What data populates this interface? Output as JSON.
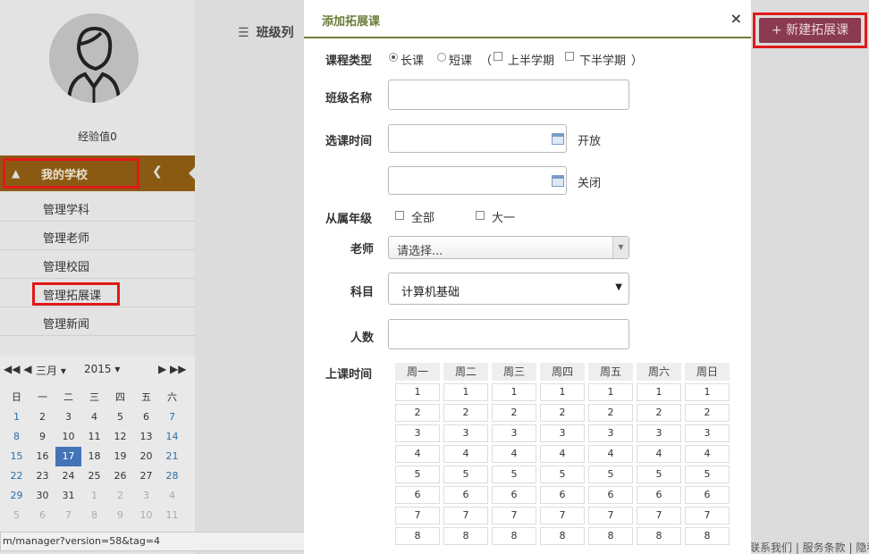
{
  "sidebar": {
    "exp_label": "经验值0",
    "school": {
      "label": "我的学校"
    },
    "menu": [
      {
        "label": "管理学科"
      },
      {
        "label": "管理老师"
      },
      {
        "label": "管理校园"
      },
      {
        "label": "管理拓展课"
      },
      {
        "label": "管理新闻"
      }
    ]
  },
  "calendar": {
    "month": "三月",
    "year": "2015",
    "weekdays": [
      "日",
      "一",
      "二",
      "三",
      "四",
      "五",
      "六"
    ],
    "rows": [
      [
        "1",
        "2",
        "3",
        "4",
        "5",
        "6",
        "7"
      ],
      [
        "8",
        "9",
        "10",
        "11",
        "12",
        "13",
        "14"
      ],
      [
        "15",
        "16",
        "17",
        "18",
        "19",
        "20",
        "21"
      ],
      [
        "22",
        "23",
        "24",
        "25",
        "26",
        "27",
        "28"
      ],
      [
        "29",
        "30",
        "31",
        "1",
        "2",
        "3",
        "4"
      ],
      [
        "5",
        "6",
        "7",
        "8",
        "9",
        "10",
        "11"
      ]
    ],
    "today": "17"
  },
  "content": {
    "title": "班级列"
  },
  "new_button": {
    "label": "新建拓展课"
  },
  "footer": {
    "links": "联系我们 | 服务条款 | 隐私"
  },
  "statusbar": {
    "url": "m/manager?version=58&tag=4"
  },
  "modal": {
    "title": "添加拓展课",
    "close": "×",
    "course_type": {
      "label": "课程类型",
      "long": "长课",
      "short": "短课",
      "paren_open": "（",
      "first_half": "上半学期",
      "second_half": "下半学期",
      "paren_close": "）"
    },
    "class_name": {
      "label": "班级名称",
      "value": ""
    },
    "select_time": {
      "label": "选课时间",
      "open": "开放",
      "close": "关闭"
    },
    "grade": {
      "label": "从属年级",
      "all": "全部",
      "year1": "大一"
    },
    "teacher": {
      "label": "老师",
      "placeholder": "请选择..."
    },
    "subject": {
      "label": "科目",
      "value": "计算机基础"
    },
    "count": {
      "label": "人数",
      "value": ""
    },
    "schedule": {
      "label": "上课时间",
      "days": [
        "周一",
        "周二",
        "周三",
        "周四",
        "周五",
        "周六",
        "周日"
      ],
      "periods": [
        "1",
        "2",
        "3",
        "4",
        "5",
        "6",
        "7",
        "8"
      ]
    }
  }
}
